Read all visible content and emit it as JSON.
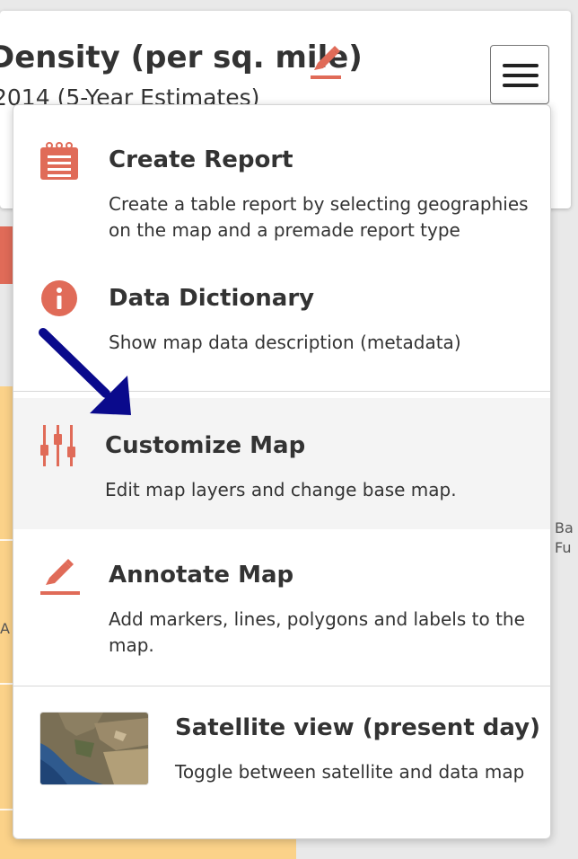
{
  "header": {
    "title": "Density (per sq. mile)",
    "subtitle": "2014 (5-Year Estimates)",
    "menu_button_icon": "hamburger-icon",
    "edit_icon": "pencil-icon"
  },
  "menu": {
    "items": [
      {
        "title": "Create Report",
        "description": "Create a table report by selecting geographies on the map and a premade report type",
        "icon": "report-icon"
      },
      {
        "title": "Data Dictionary",
        "description": "Show map data description (metadata)",
        "icon": "info-icon"
      },
      {
        "title": "Customize Map",
        "description": "Edit map layers and change base map.",
        "icon": "sliders-icon",
        "highlighted": true
      },
      {
        "title": "Annotate Map",
        "description": "Add markers, lines, polygons and labels to the map.",
        "icon": "pencil-icon"
      },
      {
        "title": "Satellite view (present day)",
        "description": "Toggle between satellite and data map",
        "icon": "satellite-thumbnail"
      }
    ]
  },
  "map_labels": {
    "label_a": "Ba",
    "label_b": "Fu",
    "label_c": "A"
  },
  "colors": {
    "accent": "#e06b58",
    "arrow": "#0a0a8c",
    "map_fill": "#fbd289",
    "highlight_bg": "#f4f4f4"
  }
}
